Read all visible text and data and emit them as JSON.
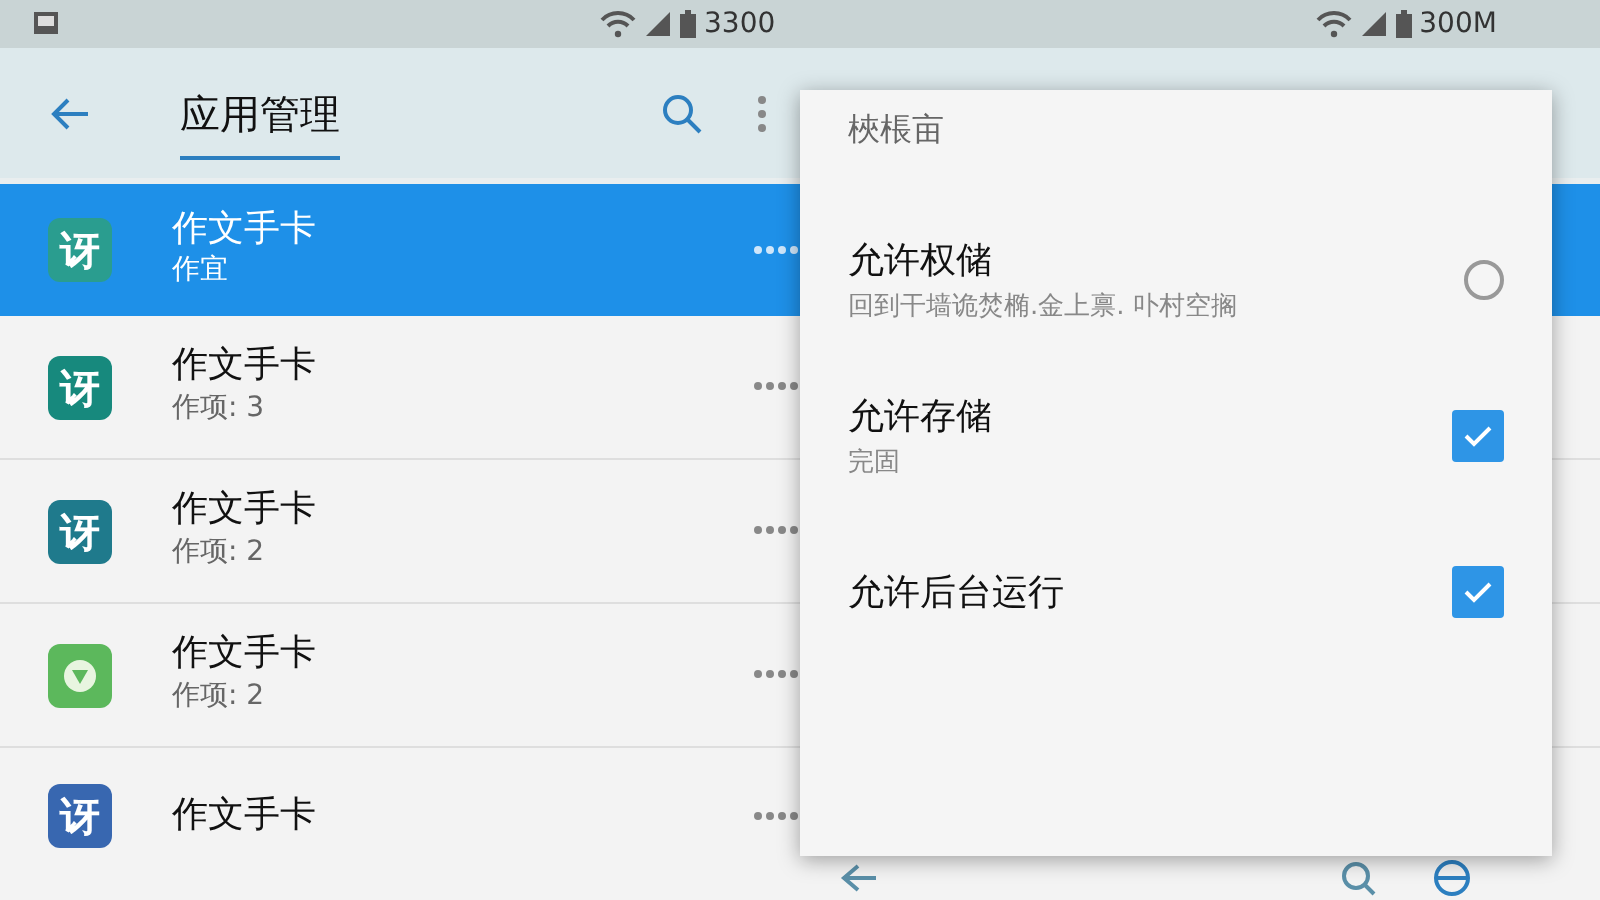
{
  "status_bar": {
    "left_text": "3300",
    "right_text": "300M"
  },
  "app_bar": {
    "title": "应用管理"
  },
  "apps": [
    {
      "name": "作文手卡",
      "detail": "作宜",
      "selected": true,
      "kind": "letter",
      "glyph": "讶",
      "color": "#2a9d8f"
    },
    {
      "name": "作文手卡",
      "detail": "作项: 3",
      "selected": false,
      "kind": "letter",
      "glyph": "讶",
      "color": "#17897d"
    },
    {
      "name": "作文手卡",
      "detail": "作项: 2",
      "selected": false,
      "kind": "letter",
      "glyph": "讶",
      "color": "#1f7a8c"
    },
    {
      "name": "作文手卡",
      "detail": "作项: 2",
      "selected": false,
      "kind": "shield",
      "color": "#5cb85c"
    },
    {
      "name": "作文手卡",
      "selected": false,
      "kind": "letter",
      "glyph": "讶",
      "color": "#3867b0"
    }
  ],
  "dialog": {
    "title": "梜棖亩",
    "options": [
      {
        "label": "允许权储",
        "detail": "回到干墙诡焚椭.金上禀. 卟村空搁",
        "kind": "radio",
        "checked": false
      },
      {
        "label": "允许存储",
        "detail": "完固",
        "kind": "checkbox",
        "checked": true
      },
      {
        "label": "允许后台运行",
        "kind": "checkbox",
        "checked": true
      }
    ]
  }
}
